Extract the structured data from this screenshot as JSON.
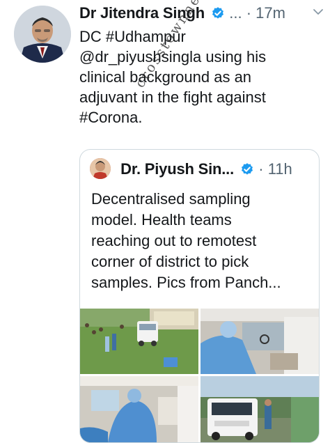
{
  "tweet": {
    "author": "Dr Jitendra Singh",
    "more": "...",
    "separator": "·",
    "time": "17m",
    "text_lines": [
      "DC #Udhampur",
      "@dr_piyushsingla using his",
      "clinical background as an",
      "adjuvant in the fight against",
      "#Corona."
    ]
  },
  "quoted": {
    "author": "Dr. Piyush Sin...",
    "separator": "·",
    "time": "11h",
    "text_lines": [
      "Decentralised sampling",
      "model. Health teams",
      "reaching out to remotest",
      "corner of district to pick",
      "samples. Pics from Panch..."
    ]
  },
  "watermark": "crosstownnews",
  "colors": {
    "verified": "#1d9bf0",
    "muted": "#536471",
    "border": "#cfd9de"
  },
  "icons": [
    "verified-badge-icon",
    "chevron-down-icon"
  ]
}
